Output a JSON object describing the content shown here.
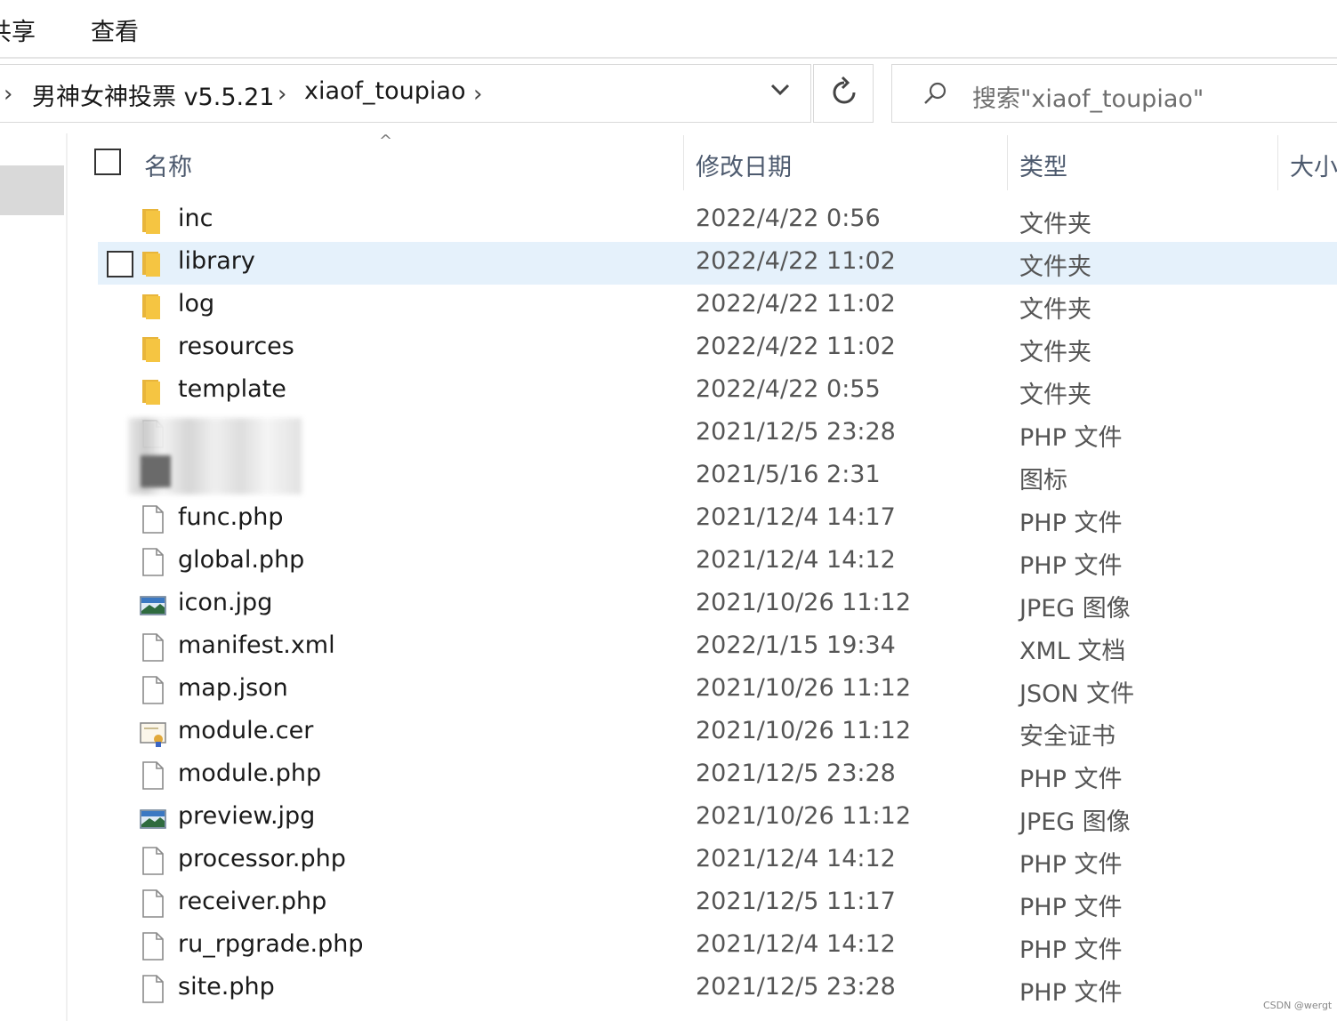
{
  "ribbon": {
    "tabs": [
      {
        "label": "共享",
        "visible_text": "共享"
      },
      {
        "label": "查看"
      }
    ]
  },
  "address_bar": {
    "crumbs": [
      "男神女神投票 v5.5.21",
      "xiaof_toupiao"
    ]
  },
  "search": {
    "placeholder": "搜索\"xiaof_toupiao\""
  },
  "columns": {
    "name": "名称",
    "date": "修改日期",
    "type": "类型",
    "size": "大小"
  },
  "files": [
    {
      "name": "inc",
      "date": "2022/4/22 0:56",
      "type": "文件夹",
      "icon": "folder-icon"
    },
    {
      "name": "library",
      "date": "2022/4/22 11:02",
      "type": "文件夹",
      "icon": "folder-icon",
      "selected": true
    },
    {
      "name": "log",
      "date": "2022/4/22 11:02",
      "type": "文件夹",
      "icon": "folder-icon"
    },
    {
      "name": "resources",
      "date": "2022/4/22 11:02",
      "type": "文件夹",
      "icon": "folder-icon"
    },
    {
      "name": "template",
      "date": "2022/4/22 0:55",
      "type": "文件夹",
      "icon": "folder-icon"
    },
    {
      "name": "",
      "date": "2021/12/5 23:28",
      "type": "PHP 文件",
      "icon": "file-icon",
      "obscured": true
    },
    {
      "name": "",
      "date": "2021/5/16 2:31",
      "type": "图标",
      "icon": "ico-icon",
      "obscured": true
    },
    {
      "name": "func.php",
      "date": "2021/12/4 14:17",
      "type": "PHP 文件",
      "icon": "file-icon"
    },
    {
      "name": "global.php",
      "date": "2021/12/4 14:12",
      "type": "PHP 文件",
      "icon": "file-icon"
    },
    {
      "name": "icon.jpg",
      "date": "2021/10/26 11:12",
      "type": "JPEG 图像",
      "icon": "image-icon"
    },
    {
      "name": "manifest.xml",
      "date": "2022/1/15 19:34",
      "type": "XML 文档",
      "icon": "file-icon"
    },
    {
      "name": "map.json",
      "date": "2021/10/26 11:12",
      "type": "JSON 文件",
      "icon": "file-icon"
    },
    {
      "name": "module.cer",
      "date": "2021/10/26 11:12",
      "type": "安全证书",
      "icon": "certificate-icon"
    },
    {
      "name": "module.php",
      "date": "2021/12/5 23:28",
      "type": "PHP 文件",
      "icon": "file-icon"
    },
    {
      "name": "preview.jpg",
      "date": "2021/10/26 11:12",
      "type": "JPEG 图像",
      "icon": "image-icon"
    },
    {
      "name": "processor.php",
      "date": "2021/12/4 14:12",
      "type": "PHP 文件",
      "icon": "file-icon"
    },
    {
      "name": "receiver.php",
      "date": "2021/12/5 11:17",
      "type": "PHP 文件",
      "icon": "file-icon"
    },
    {
      "name": "ru_rpgrade.php",
      "date": "2021/12/4 14:12",
      "type": "PHP 文件",
      "icon": "file-icon"
    },
    {
      "name": "site.php",
      "date": "2021/12/5 23:28",
      "type": "PHP 文件",
      "icon": "file-icon"
    }
  ],
  "colors": {
    "selected_row": "#e5f1fb",
    "folder": "#f5c542",
    "header_text": "#4d5a6e"
  },
  "watermark": "CSDN @wergt"
}
